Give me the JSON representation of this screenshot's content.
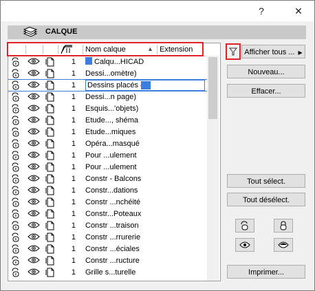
{
  "titlebar": {
    "help_label": "?",
    "close_label": "✕"
  },
  "header": {
    "title": "CALQUE"
  },
  "columns": {
    "name": "Nom calque",
    "extension": "Extension",
    "sort_indicator": "▲"
  },
  "rows": [
    {
      "num": "1",
      "name": "Calqu...HICAD",
      "has_flag": true
    },
    {
      "num": "1",
      "name": "Dessi...omètre)"
    },
    {
      "num": "1",
      "name": "Dessins placés (l",
      "selected": true
    },
    {
      "num": "1",
      "name": "Dessi...n page)"
    },
    {
      "num": "1",
      "name": "Esquis...'objets)"
    },
    {
      "num": "1",
      "name": "Etude..., shéma"
    },
    {
      "num": "1",
      "name": "Etude...miques"
    },
    {
      "num": "1",
      "name": "Opéra...masqué"
    },
    {
      "num": "1",
      "name": "Pour ...ulement"
    },
    {
      "num": "1",
      "name": "Pour ...ulement"
    },
    {
      "num": "1",
      "name": "Constr - Balcons"
    },
    {
      "num": "1",
      "name": "Constr...dations"
    },
    {
      "num": "1",
      "name": "Constr ...nchéité"
    },
    {
      "num": "1",
      "name": "Constr...Poteaux"
    },
    {
      "num": "1",
      "name": "Constr ...traison"
    },
    {
      "num": "1",
      "name": "Constr ...rrurerie"
    },
    {
      "num": "1",
      "name": "Constr ...éciales"
    },
    {
      "num": "1",
      "name": "Constr ...ructure"
    },
    {
      "num": "1",
      "name": "Grille s...turelle"
    }
  ],
  "buttons": {
    "show_all": "Afficher tous ...",
    "new": "Nouveau...",
    "delete": "Effacer...",
    "select_all": "Tout sélect.",
    "deselect_all": "Tout désélect.",
    "print": "Imprimer..."
  },
  "colors": {
    "highlight": "#e0202a",
    "selection": "#3b7de0"
  }
}
